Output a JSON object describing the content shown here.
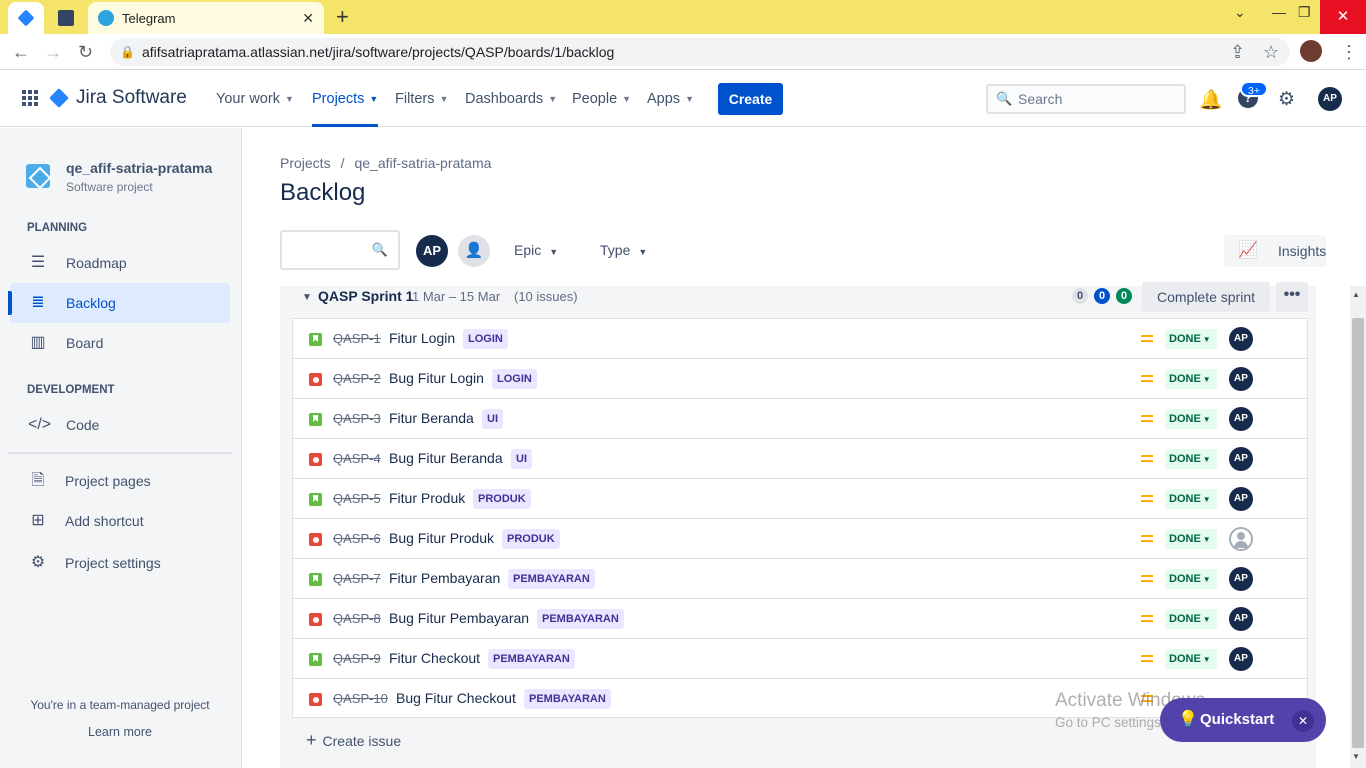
{
  "browser": {
    "tab_title": "Telegram",
    "url": "afifsatriapratama.atlassian.net/jira/software/projects/QASP/boards/1/backlog"
  },
  "jira_nav": {
    "brand": "Jira Software",
    "menus": [
      "Your work",
      "Projects",
      "Filters",
      "Dashboards",
      "People",
      "Apps"
    ],
    "create": "Create",
    "search_placeholder": "Search",
    "help_badge": "3+",
    "user_initials": "AP"
  },
  "sidebar": {
    "project_name": "qe_afif-satria-pratama",
    "project_type": "Software project",
    "planning_heading": "PLANNING",
    "development_heading": "DEVELOPMENT",
    "items": {
      "roadmap": "Roadmap",
      "backlog": "Backlog",
      "board": "Board",
      "code": "Code",
      "project_pages": "Project pages",
      "add_shortcut": "Add shortcut",
      "project_settings": "Project settings"
    },
    "team_note": "You're in a team-managed project",
    "learn_more": "Learn more"
  },
  "main": {
    "breadcrumb": [
      "Projects",
      "qe_afif-satria-pratama"
    ],
    "title": "Backlog",
    "filter_avatar": "AP",
    "filters": [
      "Epic",
      "Type"
    ],
    "insights": "Insights"
  },
  "sprint": {
    "name": "QASP Sprint 1",
    "dates": "1 Mar – 15 Mar",
    "issue_count": "(10 issues)",
    "counts": {
      "todo": "0",
      "in_progress": "0",
      "done": "0"
    },
    "complete_button": "Complete sprint",
    "more_button": "•••",
    "issues": [
      {
        "type": "story",
        "key": "QASP-1",
        "summary": "Fitur Login",
        "epic": "LOGIN",
        "status": "DONE",
        "assignee": "AP"
      },
      {
        "type": "bug",
        "key": "QASP-2",
        "summary": "Bug Fitur Login",
        "epic": "LOGIN",
        "status": "DONE",
        "assignee": "AP"
      },
      {
        "type": "story",
        "key": "QASP-3",
        "summary": "Fitur Beranda",
        "epic": "UI",
        "status": "DONE",
        "assignee": "AP"
      },
      {
        "type": "bug",
        "key": "QASP-4",
        "summary": "Bug Fitur Beranda",
        "epic": "UI",
        "status": "DONE",
        "assignee": "AP"
      },
      {
        "type": "story",
        "key": "QASP-5",
        "summary": "Fitur Produk",
        "epic": "PRODUK",
        "status": "DONE",
        "assignee": "AP"
      },
      {
        "type": "bug",
        "key": "QASP-6",
        "summary": "Bug Fitur Produk",
        "epic": "PRODUK",
        "status": "DONE",
        "assignee": ""
      },
      {
        "type": "story",
        "key": "QASP-7",
        "summary": "Fitur Pembayaran",
        "epic": "PEMBAYARAN",
        "status": "DONE",
        "assignee": "AP"
      },
      {
        "type": "bug",
        "key": "QASP-8",
        "summary": "Bug Fitur Pembayaran",
        "epic": "PEMBAYARAN",
        "status": "DONE",
        "assignee": "AP"
      },
      {
        "type": "story",
        "key": "QASP-9",
        "summary": "Fitur Checkout",
        "epic": "PEMBAYARAN",
        "status": "DONE",
        "assignee": "AP"
      },
      {
        "type": "bug",
        "key": "QASP-10",
        "summary": "Bug Fitur Checkout",
        "epic": "PEMBAYARAN",
        "status": "",
        "assignee": ""
      }
    ],
    "create_issue": "Create issue"
  },
  "watermark": {
    "line1": "Activate Windows",
    "line2": "Go to PC settings to activate Windows."
  },
  "quickstart": "Quickstart"
}
